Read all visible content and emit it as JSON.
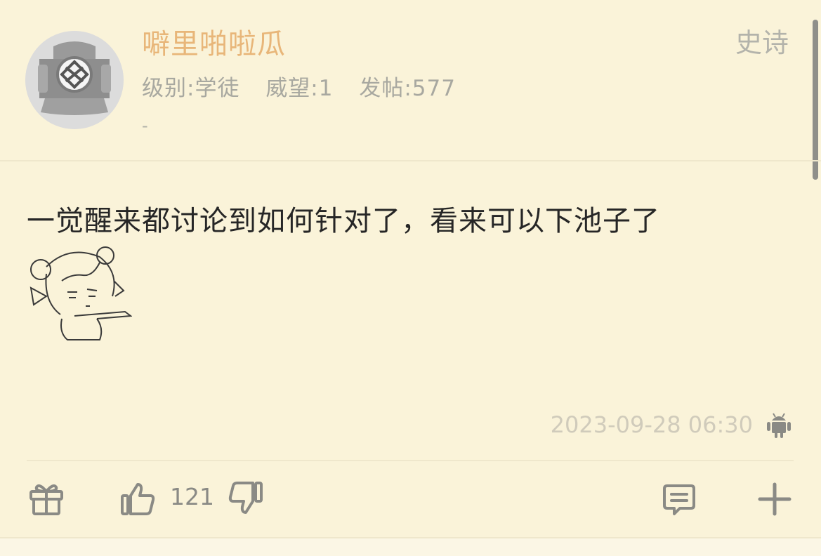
{
  "post": {
    "username": "噼里啪啦瓜",
    "level": "级别:学徒",
    "reputation": "威望:1",
    "post_count": "发帖:577",
    "signature": "-",
    "floor_label": "史诗",
    "content": "一觉醒来都讨论到如何针对了，看来可以下池子了",
    "timestamp": "2023-09-28 06:30",
    "device_icon": "android-icon",
    "sticker_icon": "anime-girl-sticker"
  },
  "actions": {
    "gift_icon": "gift-icon",
    "like_icon": "thumbs-up-icon",
    "like_count": "121",
    "dislike_icon": "thumbs-down-icon",
    "comment_icon": "comment-icon",
    "more_icon": "plus-icon"
  },
  "colors": {
    "background": "#faf3d9",
    "username": "#e8b679",
    "meta_text": "#a8a8a0",
    "content_text": "#262626",
    "timestamp": "#d0cbbb",
    "icon": "#8a8a85"
  }
}
